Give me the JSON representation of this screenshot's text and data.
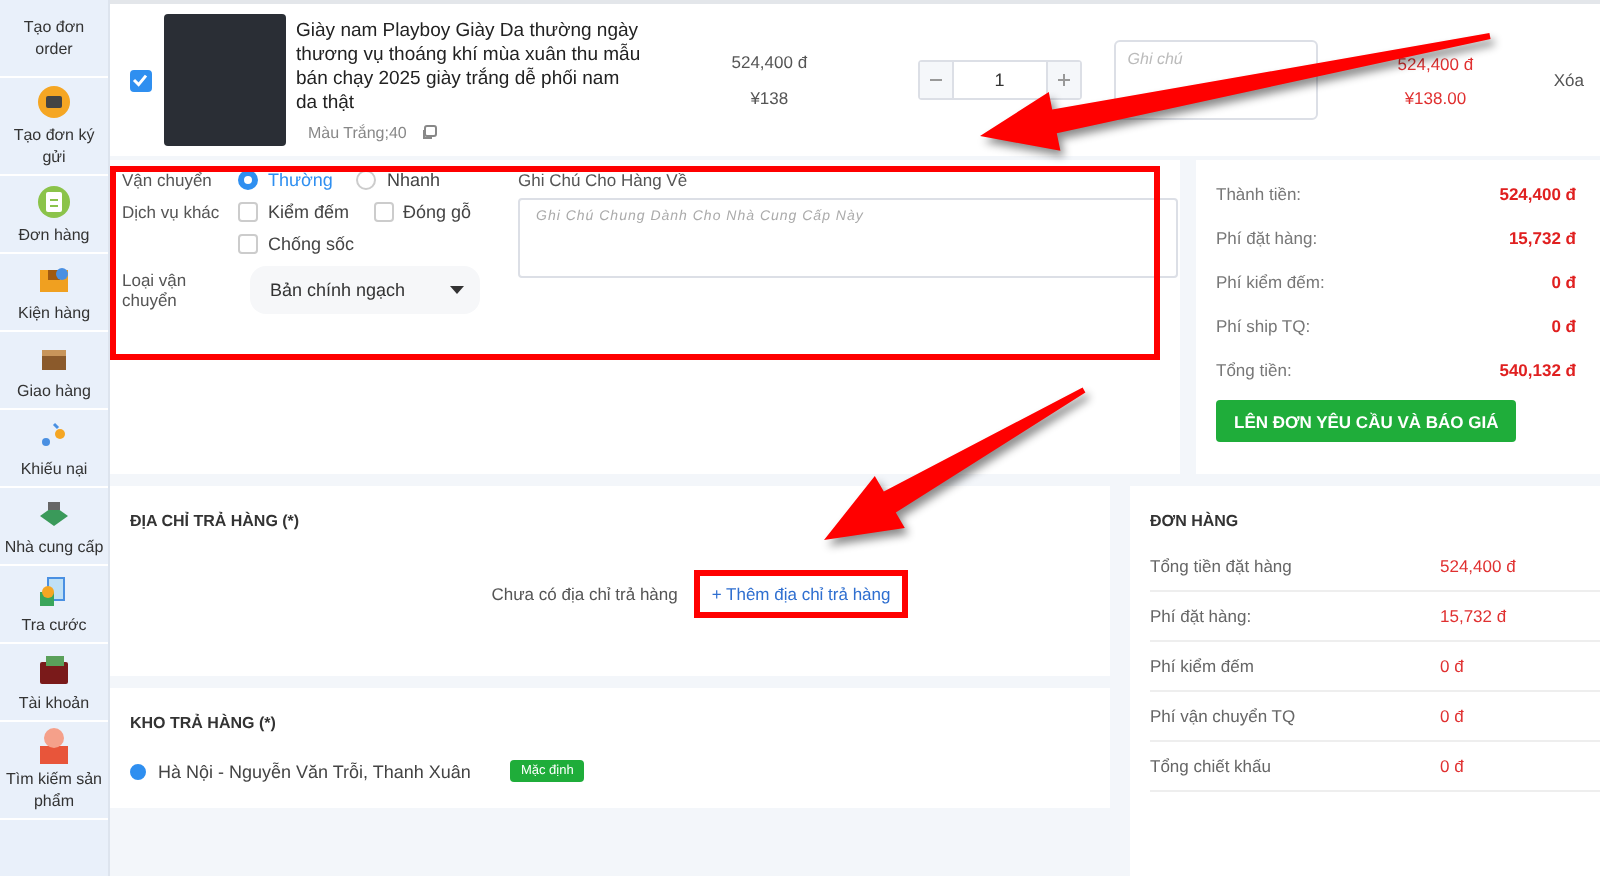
{
  "sidebar": {
    "items": [
      {
        "label": "Tạo đơn order"
      },
      {
        "label": "Tạo đơn ký gửi"
      },
      {
        "label": "Đơn hàng"
      },
      {
        "label": "Kiện hàng"
      },
      {
        "label": "Giao hàng"
      },
      {
        "label": "Khiếu nại"
      },
      {
        "label": "Nhà cung cấp"
      },
      {
        "label": "Tra cước"
      },
      {
        "label": "Tài khoản"
      },
      {
        "label": "Tìm kiếm sản phẩm"
      }
    ]
  },
  "product": {
    "checked": true,
    "title": "Giày nam Playboy Giày Da thường ngày thương vụ thoáng khí mùa xuân thu mẫu bán chạy 2025 giày trắng dễ phối nam da thật",
    "variant": "Màu Trắng;40",
    "price_vnd": "524,400 đ",
    "price_cny": "¥138",
    "quantity": "1",
    "note_placeholder": "Ghi chú",
    "total_vnd": "524,400 đ",
    "total_cny": "¥138.00",
    "delete": "Xóa"
  },
  "shipping": {
    "highlighted": true,
    "label": "Vận chuyển",
    "options": [
      {
        "label": "Thường",
        "selected": true
      },
      {
        "label": "Nhanh",
        "selected": false
      }
    ],
    "services_label": "Dịch vụ khác",
    "services": [
      {
        "label": "Kiểm đếm",
        "checked": false
      },
      {
        "label": "Đóng gỗ",
        "checked": false
      },
      {
        "label": "Chống sốc",
        "checked": false
      }
    ],
    "type_label": "Loại vận chuyển",
    "type_value": "Bản chính ngạch",
    "note_label": "Ghi Chú Cho Hàng Về",
    "note_placeholder": "Ghi Chú Chung Dành Cho Nhà Cung Cấp Này"
  },
  "totals": {
    "rows": [
      {
        "label": "Thành tiền:",
        "value": "524,400 đ"
      },
      {
        "label": "Phí đặt hàng:",
        "value": "15,732 đ"
      },
      {
        "label": "Phí kiểm đếm:",
        "value": "0 đ"
      },
      {
        "label": "Phí ship TQ:",
        "value": "0 đ"
      },
      {
        "label": "Tổng tiền:",
        "value": "540,132 đ"
      }
    ],
    "button": "LÊN ĐƠN YÊU CẦU VÀ BÁO GIÁ"
  },
  "return_address": {
    "title": "ĐỊA CHỈ TRẢ HÀNG (*)",
    "empty_text": "Chưa có địa chỉ trả hàng",
    "add_link": "+ Thêm địa chỉ trả hàng",
    "add_link_highlighted": true
  },
  "warehouse": {
    "title": "KHO TRẢ HÀNG (*)",
    "options": [
      {
        "label": "Hà Nội - Nguyễn Văn Trỗi, Thanh Xuân",
        "selected": true,
        "badge": "Mặc định"
      }
    ]
  },
  "order_summary": {
    "title": "ĐƠN HÀNG",
    "rows": [
      {
        "label": "Tổng tiền đặt hàng",
        "value": "524,400 đ"
      },
      {
        "label": "Phí đặt hàng:",
        "value": "15,732 đ"
      },
      {
        "label": "Phí kiểm đếm",
        "value": "0 đ"
      },
      {
        "label": "Phí vận chuyển TQ",
        "value": "0 đ"
      },
      {
        "label": "Tổng chiết khấu",
        "value": "0 đ"
      }
    ]
  },
  "annotations": [
    {
      "kind": "arrow"
    },
    {
      "kind": "arrow"
    }
  ]
}
